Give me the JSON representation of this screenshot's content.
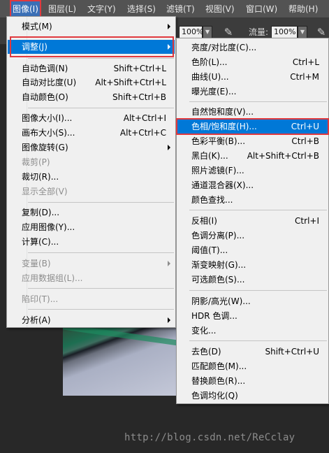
{
  "menubar": {
    "items": [
      {
        "label": "图像(I)",
        "active": true
      },
      {
        "label": "图层(L)"
      },
      {
        "label": "文字(Y)"
      },
      {
        "label": "选择(S)"
      },
      {
        "label": "滤镜(T)"
      },
      {
        "label": "视图(V)"
      },
      {
        "label": "窗口(W)"
      },
      {
        "label": "帮助(H)"
      }
    ]
  },
  "options_bar": {
    "opacity_value": "100%",
    "flow_label": "流量:",
    "flow_value": "100%"
  },
  "image_menu": {
    "items": [
      {
        "label": "模式(M)",
        "shortcut": "",
        "submenu": true
      },
      {
        "label": "调整(J)",
        "shortcut": "",
        "submenu": true,
        "highlighted": true
      },
      {
        "label": "自动色调(N)",
        "shortcut": "Shift+Ctrl+L"
      },
      {
        "label": "自动对比度(U)",
        "shortcut": "Alt+Shift+Ctrl+L"
      },
      {
        "label": "自动颜色(O)",
        "shortcut": "Shift+Ctrl+B"
      },
      {
        "label": "图像大小(I)...",
        "shortcut": "Alt+Ctrl+I"
      },
      {
        "label": "画布大小(S)...",
        "shortcut": "Alt+Ctrl+C"
      },
      {
        "label": "图像旋转(G)",
        "shortcut": "",
        "submenu": true
      },
      {
        "label": "裁剪(P)",
        "shortcut": "",
        "disabled": true
      },
      {
        "label": "裁切(R)...",
        "shortcut": ""
      },
      {
        "label": "显示全部(V)",
        "shortcut": "",
        "disabled": true
      },
      {
        "label": "复制(D)...",
        "shortcut": ""
      },
      {
        "label": "应用图像(Y)...",
        "shortcut": ""
      },
      {
        "label": "计算(C)...",
        "shortcut": ""
      },
      {
        "label": "变量(B)",
        "shortcut": "",
        "submenu": true,
        "disabled": true
      },
      {
        "label": "应用数据组(L)...",
        "shortcut": "",
        "disabled": true
      },
      {
        "label": "陷印(T)...",
        "shortcut": "",
        "disabled": true
      },
      {
        "label": "分析(A)",
        "shortcut": "",
        "submenu": true
      }
    ]
  },
  "adjust_menu": {
    "items": [
      {
        "label": "亮度/对比度(C)...",
        "shortcut": ""
      },
      {
        "label": "色阶(L)...",
        "shortcut": "Ctrl+L"
      },
      {
        "label": "曲线(U)...",
        "shortcut": "Ctrl+M"
      },
      {
        "label": "曝光度(E)...",
        "shortcut": ""
      },
      {
        "label": "自然饱和度(V)...",
        "shortcut": ""
      },
      {
        "label": "色相/饱和度(H)...",
        "shortcut": "Ctrl+U",
        "highlighted": true
      },
      {
        "label": "色彩平衡(B)...",
        "shortcut": "Ctrl+B"
      },
      {
        "label": "黑白(K)...",
        "shortcut": "Alt+Shift+Ctrl+B"
      },
      {
        "label": "照片滤镜(F)...",
        "shortcut": ""
      },
      {
        "label": "通道混合器(X)...",
        "shortcut": ""
      },
      {
        "label": "颜色查找...",
        "shortcut": ""
      },
      {
        "label": "反相(I)",
        "shortcut": "Ctrl+I"
      },
      {
        "label": "色调分离(P)...",
        "shortcut": ""
      },
      {
        "label": "阈值(T)...",
        "shortcut": ""
      },
      {
        "label": "渐变映射(G)...",
        "shortcut": ""
      },
      {
        "label": "可选颜色(S)...",
        "shortcut": ""
      },
      {
        "label": "阴影/高光(W)...",
        "shortcut": ""
      },
      {
        "label": "HDR 色调...",
        "shortcut": ""
      },
      {
        "label": "变化...",
        "shortcut": ""
      },
      {
        "label": "去色(D)",
        "shortcut": "Shift+Ctrl+U"
      },
      {
        "label": "匹配颜色(M)...",
        "shortcut": ""
      },
      {
        "label": "替换颜色(R)...",
        "shortcut": ""
      },
      {
        "label": "色调均化(Q)",
        "shortcut": ""
      }
    ]
  },
  "watermark": "http://blog.csdn.net/ReCclay",
  "colors": {
    "highlight": "#0078d7",
    "annotation_red": "#e0393e",
    "menubar_bg": "#535353"
  }
}
